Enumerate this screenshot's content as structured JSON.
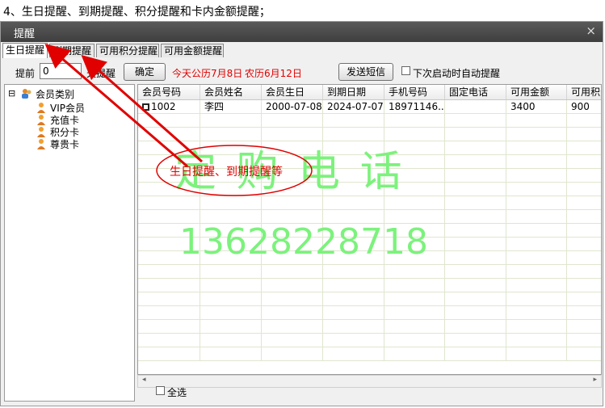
{
  "caption": "4、生日提醒、到期提醒、积分提醒和卡内金额提醒；",
  "window": {
    "title": "提醒",
    "close_glyph": "×"
  },
  "tabs": [
    {
      "label": "生日提醒",
      "active": true
    },
    {
      "label": "到期提醒",
      "active": false
    },
    {
      "label": "可用积分提醒",
      "active": false
    },
    {
      "label": "可用金额提醒",
      "active": false
    }
  ],
  "toolbar": {
    "prefix_label": "提前",
    "days_value": "0",
    "suffix_label": "天提醒",
    "confirm_label": "确定",
    "today_text": "今天公历7月8日",
    "lunar_text": "农历6月12日",
    "send_sms_label": "发送短信",
    "autostart_label": "下次启动时自动提醒"
  },
  "tree": {
    "root": "会员类别",
    "expand_glyph": "⊟",
    "children": [
      "VIP会员",
      "充值卡",
      "积分卡",
      "尊贵卡"
    ]
  },
  "grid": {
    "columns": [
      "会员号码",
      "会员姓名",
      "会员生日",
      "到期日期",
      "手机号码",
      "固定电话",
      "可用金额",
      "可用积分"
    ],
    "rows": [
      [
        "1002",
        "李四",
        "2000-07-08",
        "2024-07-07",
        "18971146...",
        "",
        "3400",
        "900"
      ]
    ]
  },
  "footer": {
    "select_all_label": "全选"
  },
  "annotation": {
    "text": "生日提醒、到期提醒等"
  },
  "watermark": {
    "line1": "定 购 电 话",
    "line2": "13628228718"
  },
  "colors": {
    "accent_red": "#e00000",
    "watermark_green": "#7cf27c",
    "titlebar": "#4a4a4a"
  }
}
